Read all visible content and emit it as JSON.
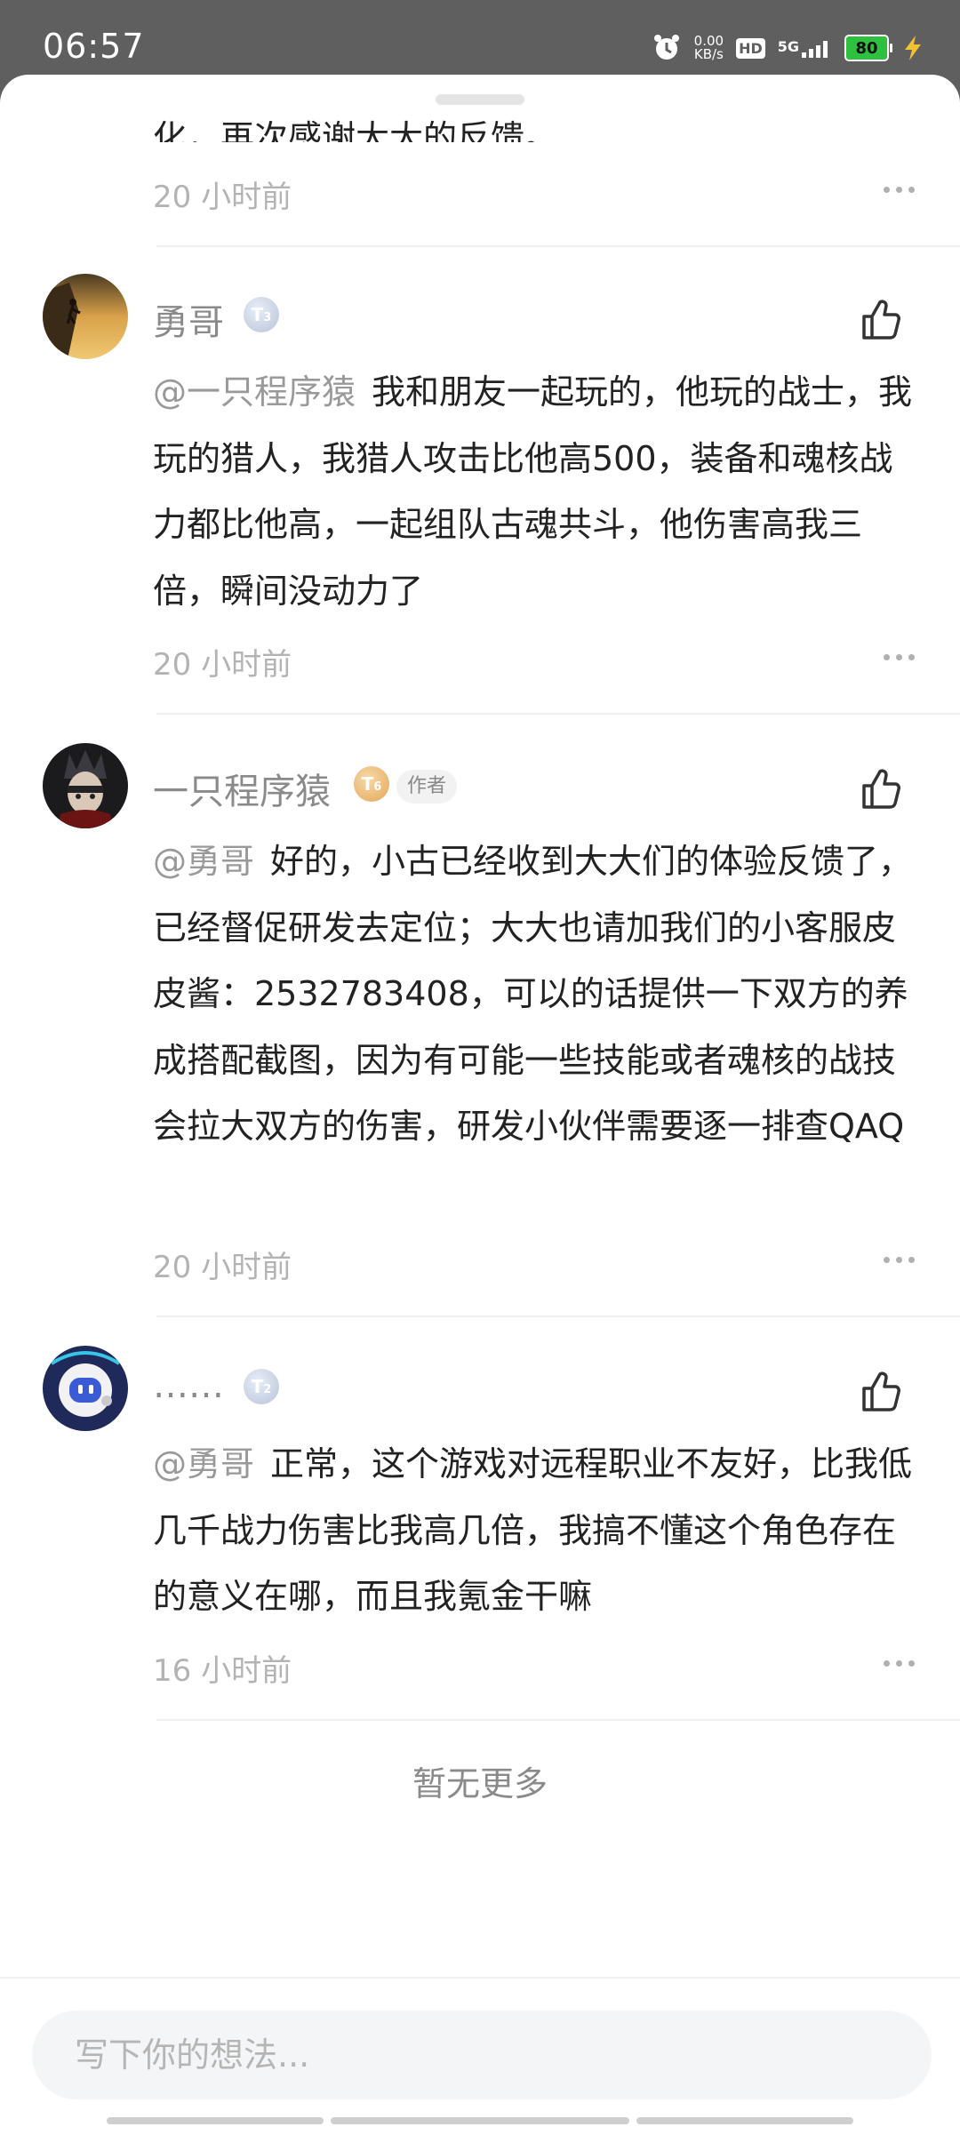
{
  "status_bar": {
    "time": "06:57",
    "net_speed_value": "0.00",
    "net_speed_unit": "KB/s",
    "hd": "HD",
    "network": "5G",
    "battery": "80"
  },
  "partial_text": "化，再次感谢大大的反馈。",
  "partial_time": "20 小时前",
  "comments": [
    {
      "username": "勇哥",
      "level": "3",
      "mention": "@一只程序猿",
      "text": "我和朋友一起玩的，他玩的战士，我玩的猎人，我猎人攻击比他高500，装备和魂核战力都比他高，一起组队古魂共斗，他伤害高我三倍，瞬间没动力了",
      "time": "20 小时前"
    },
    {
      "username": "一只程序猿",
      "level": "6",
      "author_tag": "作者",
      "mention": "@勇哥",
      "text": "好的，小古已经收到大大们的体验反馈了，已经督促研发去定位；大大也请加我们的小客服皮皮酱：2532783408，可以的话提供一下双方的养成搭配截图，因为有可能一些技能或者魂核的战技会拉大双方的伤害，研发小伙伴需要逐一排查QAQ",
      "time": "20 小时前"
    },
    {
      "username": "……",
      "level": "2",
      "mention": "@勇哥",
      "text": "正常，这个游戏对远程职业不友好，比我低几千战力伤害比我高几倍，我搞不懂这个角色存在的意义在哪，而且我氪金干嘛",
      "time": "16 小时前"
    }
  ],
  "no_more": "暂无更多",
  "input": {
    "placeholder": "写下你的想法..."
  }
}
